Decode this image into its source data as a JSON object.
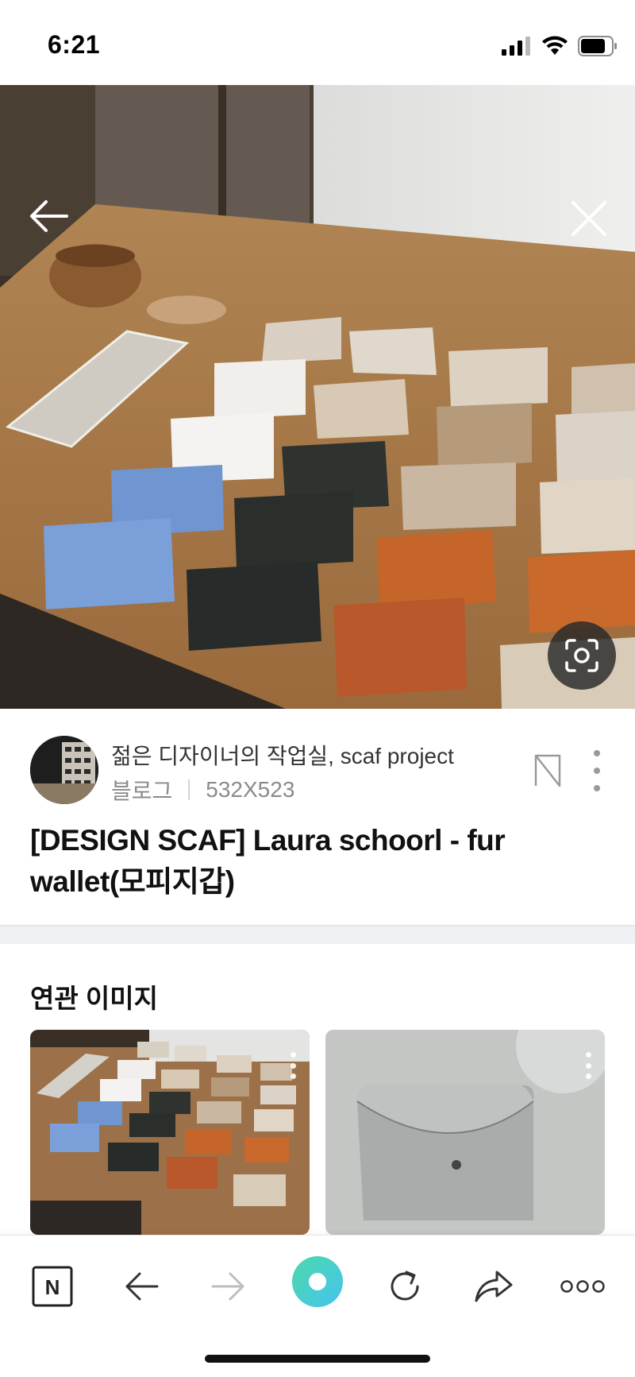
{
  "status_bar": {
    "time": "6:21"
  },
  "hero": {
    "image_description": ""
  },
  "source": {
    "name": "젊은 디자이너의 작업실, scaf project",
    "type": "블로그",
    "dimensions": "532X523"
  },
  "title": "[DESIGN SCAF] Laura schoorl - fur wallet(모피지갑)",
  "related": {
    "heading": "연관 이미지"
  },
  "toolbar": {
    "home_logo": "N"
  },
  "colors": {
    "accent_start": "#4cd9a8",
    "accent_end": "#45c4f0",
    "divider": "#eef0f3"
  },
  "icons": [
    "signal-icon",
    "wifi-icon",
    "battery-icon",
    "back-arrow-icon",
    "close-icon",
    "lens-search-icon",
    "bookmark-icon",
    "more-vertical-icon",
    "naver-home-icon",
    "nav-back-icon",
    "nav-forward-icon",
    "green-dot-icon",
    "refresh-icon",
    "share-icon",
    "more-horizontal-icon"
  ]
}
